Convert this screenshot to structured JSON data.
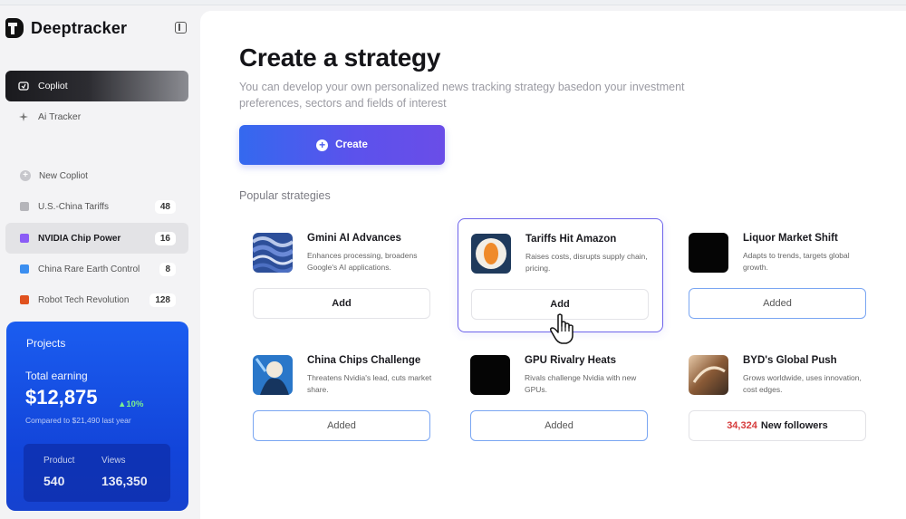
{
  "app": {
    "name": "Deeptracker"
  },
  "sidebar": {
    "nav": [
      {
        "label": "Copliot",
        "icon": "copilot-icon",
        "active": true
      },
      {
        "label": "Ai Tracker",
        "icon": "sparkle-icon",
        "active": false
      }
    ],
    "new_label": "New Copliot",
    "items": [
      {
        "label": "U.S.-China Tariffs",
        "count": "48",
        "color": "#b5b5ba"
      },
      {
        "label": "NVIDIA Chip Power",
        "count": "16",
        "color": "#8b5cf6"
      },
      {
        "label": "China Rare Earth Control",
        "count": "8",
        "color": "#3b8ef0"
      },
      {
        "label": "Robot Tech Revolution",
        "count": "128",
        "color": "#e0521f"
      }
    ],
    "projects": {
      "title": "Projects",
      "earning_label": "Total earning",
      "earning_value": "$12,875",
      "delta": "▲10%",
      "compared": "Compared to $21,490 last year",
      "product_label": "Product",
      "product_value": "540",
      "views_label": "Views",
      "views_value": "136,350"
    }
  },
  "main": {
    "title": "Create a strategy",
    "subtitle": "You can develop your own personalized news tracking strategy basedon your investment preferences, sectors and fields of interest",
    "create_label": "Create",
    "section_label": "Popular strategies",
    "cards": [
      {
        "title": "Gmini AI Advances",
        "desc": "Enhances processing, broadens Google's AI applications.",
        "button": "Add",
        "state": "add",
        "thumb": "abstract-blue"
      },
      {
        "title": "Tariffs Hit Amazon",
        "desc": "Raises costs, disrupts supply chain, pricing.",
        "button": "Add",
        "state": "add",
        "thumb": "orange-ring"
      },
      {
        "title": "Liquor Market Shift",
        "desc": "Adapts to trends, targets global growth.",
        "button": "Added",
        "state": "added",
        "thumb": "black"
      },
      {
        "title": "China Chips Challenge",
        "desc": "Threatens Nvidia's lead, cuts market share.",
        "button": "Added",
        "state": "added",
        "thumb": "blue-figure"
      },
      {
        "title": "GPU Rivalry Heats",
        "desc": "Rivals challenge Nvidia with new GPUs.",
        "button": "Added",
        "state": "added",
        "thumb": "black"
      },
      {
        "title": "BYD's Global Push",
        "desc": "Grows worldwide, uses innovation, cost edges.",
        "button_number": "34,324",
        "button_text": "New followers",
        "state": "followers",
        "thumb": "bronze"
      }
    ]
  },
  "colors": {
    "accent": "#5b52ec",
    "projects_bg": "#1b5df0",
    "delta": "#7cf08e",
    "followers_num": "#d63b3b"
  }
}
